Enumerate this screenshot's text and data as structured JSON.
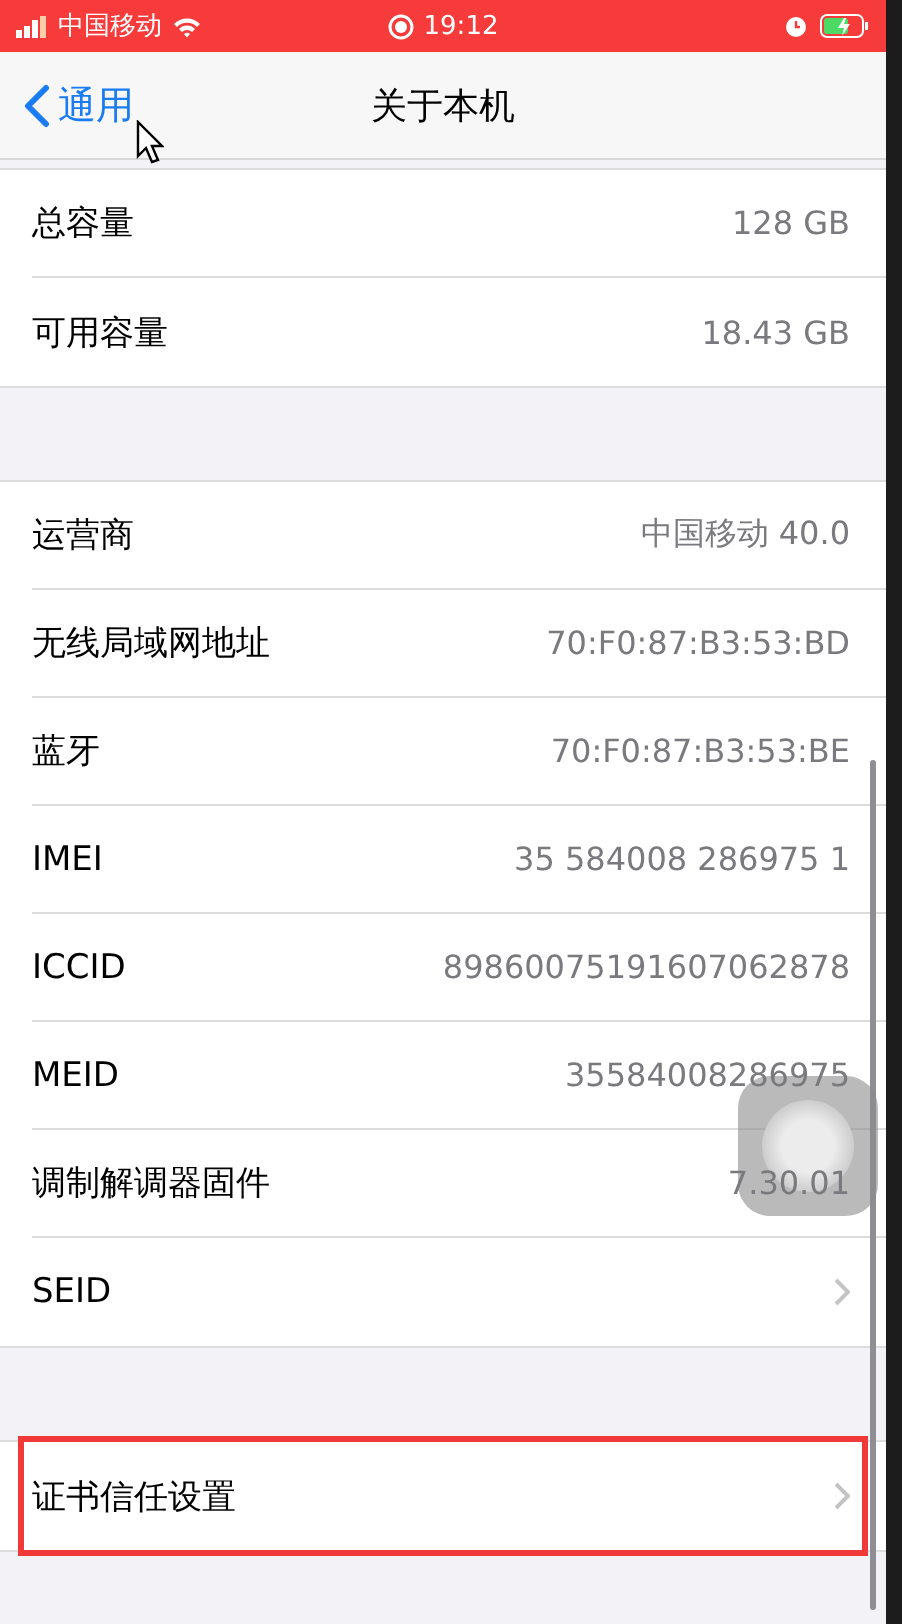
{
  "status_bar": {
    "carrier": "中国移动",
    "time": "19:12"
  },
  "nav": {
    "back": "通用",
    "title": "关于本机"
  },
  "groups": [
    {
      "rows": [
        {
          "kind": "value",
          "label": "总容量",
          "value": "128 GB"
        },
        {
          "kind": "value",
          "label": "可用容量",
          "value": "18.43 GB"
        }
      ]
    },
    {
      "rows": [
        {
          "kind": "value",
          "label": "运营商",
          "value": "中国移动 40.0"
        },
        {
          "kind": "value",
          "label": "无线局域网地址",
          "value": "70:F0:87:B3:53:BD"
        },
        {
          "kind": "value",
          "label": "蓝牙",
          "value": "70:F0:87:B3:53:BE"
        },
        {
          "kind": "value",
          "label": "IMEI",
          "value": "35 584008 286975 1"
        },
        {
          "kind": "value",
          "label": "ICCID",
          "value": "89860075191607062878"
        },
        {
          "kind": "value",
          "label": "MEID",
          "value": "35584008286975"
        },
        {
          "kind": "value",
          "label": "调制解调器固件",
          "value": "7.30.01"
        },
        {
          "kind": "link",
          "label": "SEID"
        }
      ]
    },
    {
      "rows": [
        {
          "kind": "link",
          "label": "证书信任设置",
          "highlighted": true
        }
      ]
    }
  ]
}
